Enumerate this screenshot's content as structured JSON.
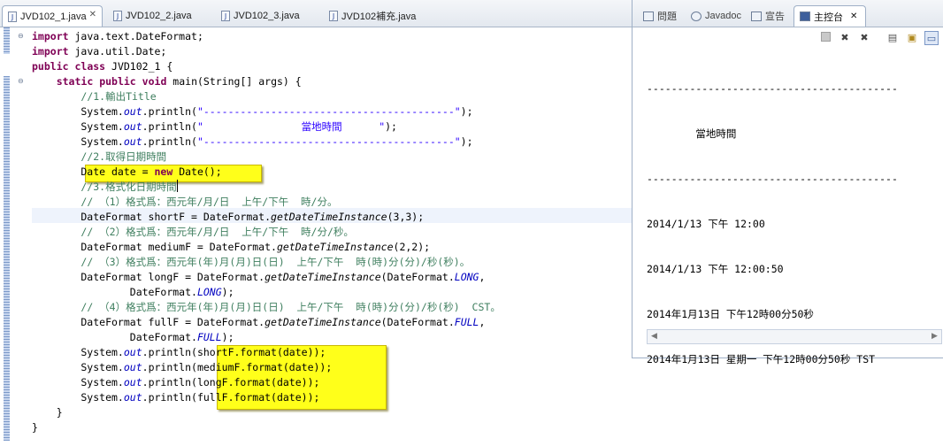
{
  "editor": {
    "tabs": [
      {
        "label": "JVD102_1.java",
        "active": true,
        "close": "✕"
      },
      {
        "label": "JVD102_2.java",
        "active": false
      },
      {
        "label": "JVD102_3.java",
        "active": false
      },
      {
        "label": "JVD102補充.java",
        "active": false
      }
    ],
    "code": [
      {
        "parts": [
          {
            "t": "import",
            "c": "kw"
          },
          {
            "t": " java.text.DateFormat;"
          }
        ]
      },
      {
        "parts": [
          {
            "t": "import",
            "c": "kw"
          },
          {
            "t": " java.util.Date;"
          }
        ]
      },
      {
        "parts": [
          {
            "t": "public",
            "c": "kw"
          },
          {
            "t": " "
          },
          {
            "t": "class",
            "c": "kw"
          },
          {
            "t": " JVD102_1 {"
          }
        ]
      },
      {
        "parts": [
          {
            "t": "    "
          },
          {
            "t": "static",
            "c": "kw"
          },
          {
            "t": " "
          },
          {
            "t": "public",
            "c": "kw"
          },
          {
            "t": " "
          },
          {
            "t": "void",
            "c": "kw"
          },
          {
            "t": " main(String[] args) {"
          }
        ]
      },
      {
        "parts": [
          {
            "t": "        "
          },
          {
            "t": "//1.輸出Title",
            "c": "cm"
          }
        ]
      },
      {
        "parts": [
          {
            "t": "        System."
          },
          {
            "t": "out",
            "c": "fld"
          },
          {
            "t": ".println("
          },
          {
            "t": "\"-----------------------------------------\"",
            "c": "st"
          },
          {
            "t": ");"
          }
        ]
      },
      {
        "parts": [
          {
            "t": "        System."
          },
          {
            "t": "out",
            "c": "fld"
          },
          {
            "t": ".println("
          },
          {
            "t": "\"                當地時間      \"",
            "c": "st"
          },
          {
            "t": ");"
          }
        ]
      },
      {
        "parts": [
          {
            "t": "        System."
          },
          {
            "t": "out",
            "c": "fld"
          },
          {
            "t": ".println("
          },
          {
            "t": "\"-----------------------------------------\"",
            "c": "st"
          },
          {
            "t": ");"
          }
        ]
      },
      {
        "parts": [
          {
            "t": "        "
          },
          {
            "t": "//2.取得日期時間",
            "c": "cm"
          }
        ]
      },
      {
        "parts": [
          {
            "t": "        Date date = "
          },
          {
            "t": "new",
            "c": "kw"
          },
          {
            "t": " Date();"
          }
        ]
      },
      {
        "parts": [
          {
            "t": "        "
          },
          {
            "t": "//3.格式化日期時間",
            "c": "cm"
          }
        ],
        "caret": true
      },
      {
        "parts": [
          {
            "t": "        "
          },
          {
            "t": "// （1）格式爲：西元年/月/日  上午/下午  時/分。",
            "c": "cm"
          }
        ]
      },
      {
        "parts": [
          {
            "t": "        DateFormat shortF = DateFormat."
          },
          {
            "t": "getDateTimeInstance",
            "c": "sm"
          },
          {
            "t": "(3,3);"
          }
        ]
      },
      {
        "parts": [
          {
            "t": "        "
          },
          {
            "t": "// （2）格式爲：西元年/月/日  上午/下午  時/分/秒。",
            "c": "cm"
          }
        ]
      },
      {
        "parts": [
          {
            "t": "        DateFormat mediumF = DateFormat."
          },
          {
            "t": "getDateTimeInstance",
            "c": "sm"
          },
          {
            "t": "(2,2);"
          }
        ]
      },
      {
        "parts": [
          {
            "t": "        "
          },
          {
            "t": "// （3）格式爲：西元年(年)月(月)日(日)  上午/下午  時(時)分(分)/秒(秒)。",
            "c": "cm"
          }
        ]
      },
      {
        "parts": [
          {
            "t": "        DateFormat longF = DateFormat."
          },
          {
            "t": "getDateTimeInstance",
            "c": "sm"
          },
          {
            "t": "(DateFormat."
          },
          {
            "t": "LONG",
            "c": "fld"
          },
          {
            "t": ","
          }
        ]
      },
      {
        "parts": [
          {
            "t": "                DateFormat."
          },
          {
            "t": "LONG",
            "c": "fld"
          },
          {
            "t": ");"
          }
        ]
      },
      {
        "parts": [
          {
            "t": "        "
          },
          {
            "t": "// （4）格式爲：西元年(年)月(月)日(日)  上午/下午  時(時)分(分)/秒(秒)  CST。",
            "c": "cm"
          }
        ]
      },
      {
        "parts": [
          {
            "t": "        DateFormat fullF = DateFormat."
          },
          {
            "t": "getDateTimeInstance",
            "c": "sm"
          },
          {
            "t": "(DateFormat."
          },
          {
            "t": "FULL",
            "c": "fld"
          },
          {
            "t": ","
          }
        ]
      },
      {
        "parts": [
          {
            "t": "                DateFormat."
          },
          {
            "t": "FULL",
            "c": "fld"
          },
          {
            "t": ");"
          }
        ]
      },
      {
        "parts": [
          {
            "t": "        System."
          },
          {
            "t": "out",
            "c": "fld"
          },
          {
            "t": ".println(shortF.format(date));"
          }
        ]
      },
      {
        "parts": [
          {
            "t": "        System."
          },
          {
            "t": "out",
            "c": "fld"
          },
          {
            "t": ".println(mediumF.format(date));"
          }
        ]
      },
      {
        "parts": [
          {
            "t": "        System."
          },
          {
            "t": "out",
            "c": "fld"
          },
          {
            "t": ".println(longF.format(date));"
          }
        ]
      },
      {
        "parts": [
          {
            "t": "        System."
          },
          {
            "t": "out",
            "c": "fld"
          },
          {
            "t": ".println(fullF.format(date));"
          }
        ]
      },
      {
        "parts": [
          {
            "t": "    }"
          }
        ]
      },
      {
        "parts": [
          {
            "t": "}"
          }
        ]
      }
    ]
  },
  "console": {
    "tabs": [
      {
        "label": "問題",
        "active": false
      },
      {
        "label": "Javadoc",
        "active": false
      },
      {
        "label": "宣告",
        "active": false
      },
      {
        "label": "主控台",
        "active": true,
        "close": "✕"
      }
    ],
    "toolbar": [
      "terminate-icon",
      "remove-launch-icon",
      "remove-all-icon",
      "clear-console-icon",
      "scroll-lock-icon",
      "display-console-icon"
    ],
    "output": [
      "-----------------------------------------",
      "        當地時間",
      "-----------------------------------------",
      "2014/1/13 下午 12:00",
      "2014/1/13 下午 12:00:50",
      "2014年1月13日 下午12時00分50秒",
      "2014年1月13日 星期一 下午12時00分50秒 TST"
    ],
    "scroll_left": "◀",
    "scroll_right": "▶"
  }
}
